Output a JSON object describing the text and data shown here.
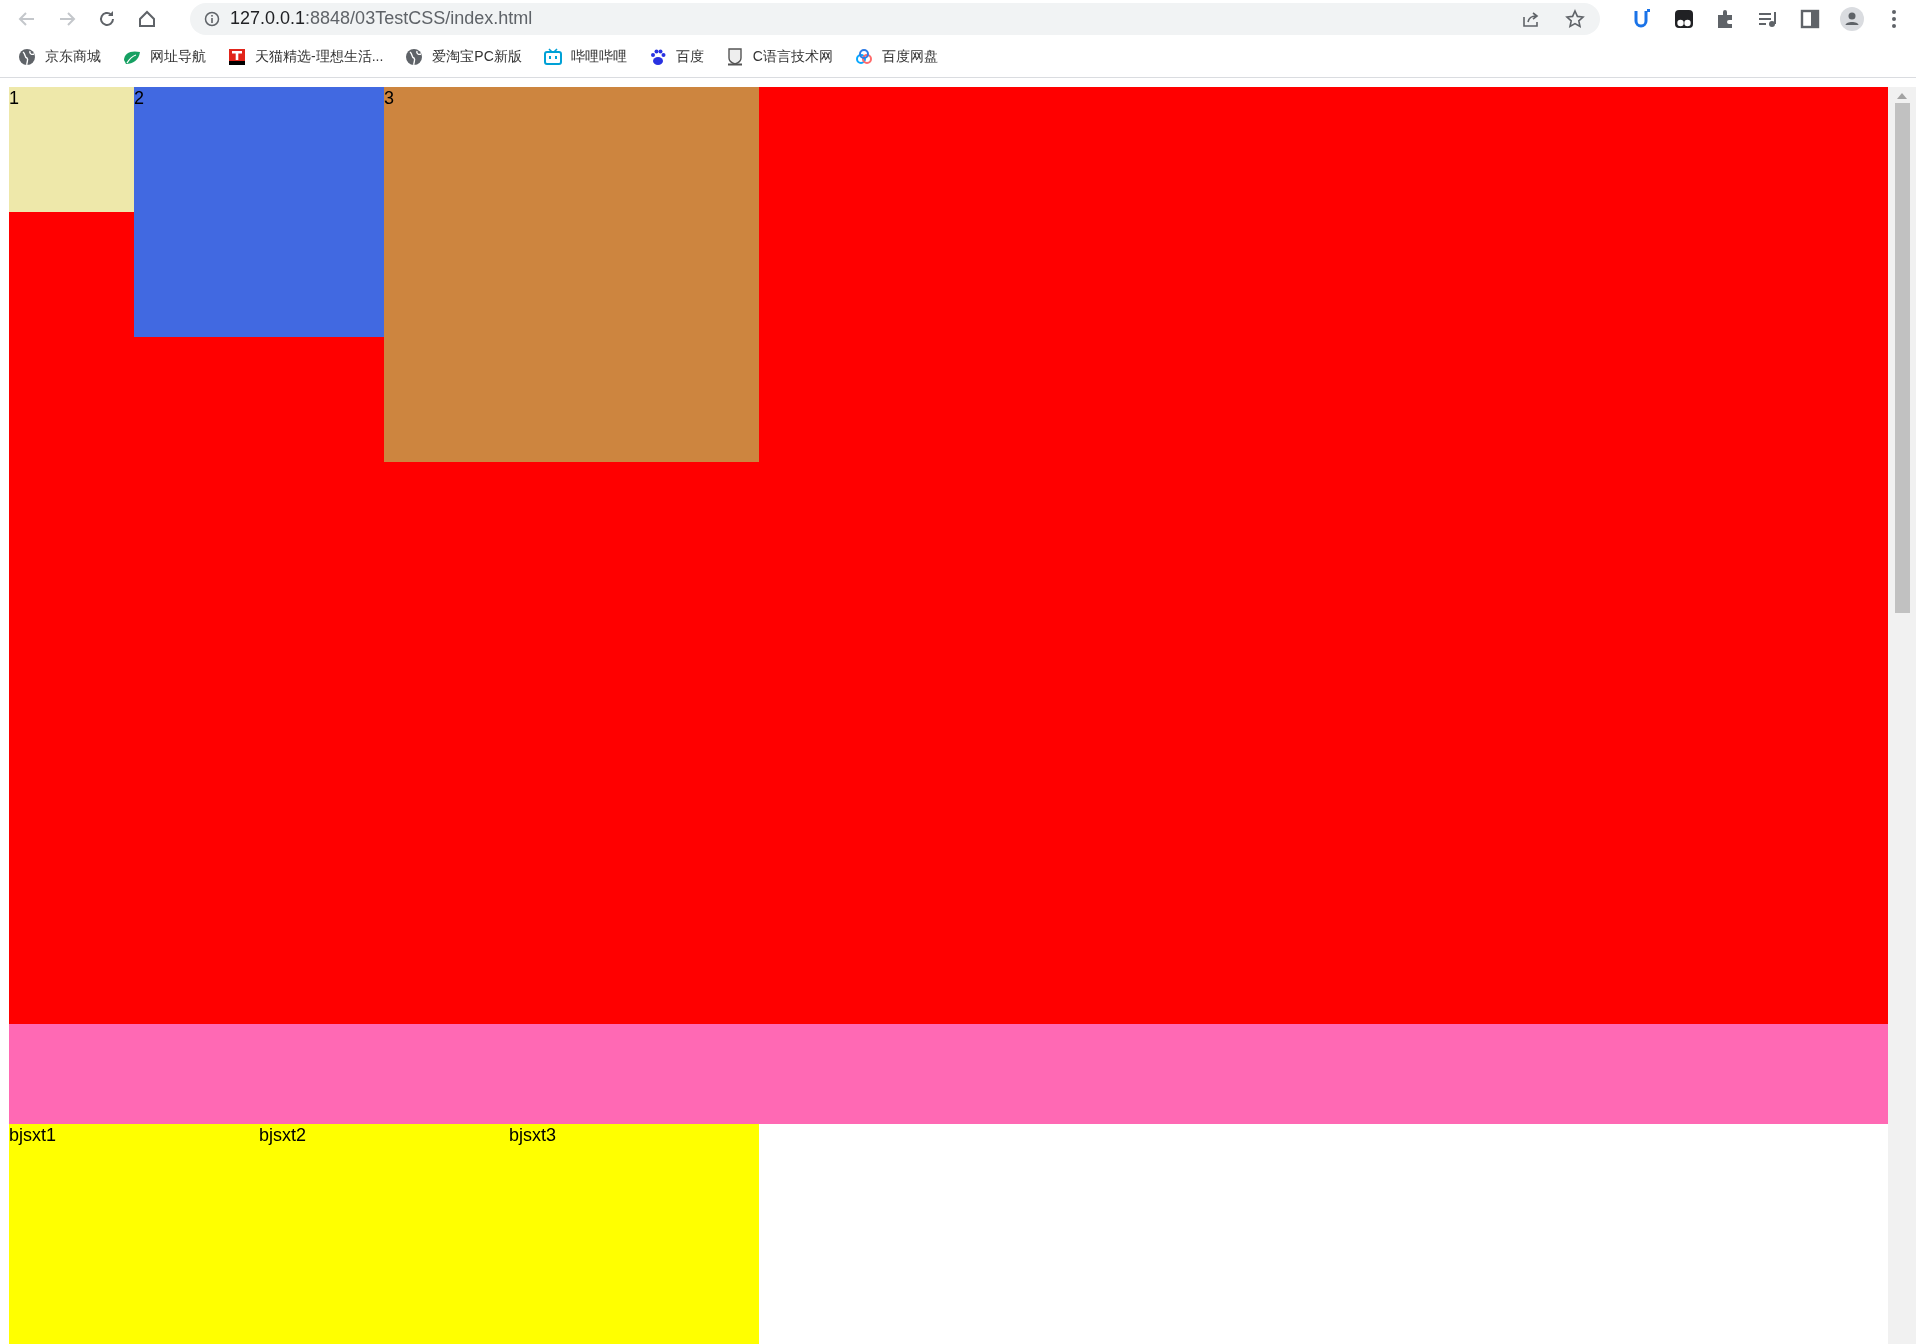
{
  "toolbar": {
    "nav_buttons": [
      {
        "kind": "back",
        "disabled": true
      },
      {
        "kind": "forward",
        "disabled": true
      },
      {
        "kind": "reload",
        "disabled": false
      },
      {
        "kind": "home",
        "disabled": false
      }
    ],
    "address": {
      "host": "127.0.0.1",
      "path": ":8848/03TestCSS/index.html"
    },
    "extensions": [
      {
        "kind": "u"
      },
      {
        "kind": "mask"
      },
      {
        "kind": "puzzle"
      },
      {
        "kind": "media"
      },
      {
        "kind": "sidepanel"
      },
      {
        "kind": "profile"
      },
      {
        "kind": "more"
      }
    ]
  },
  "bookmarks": [
    {
      "label": "京东商城",
      "kind": "globe"
    },
    {
      "label": "网址导航",
      "kind": "leaf"
    },
    {
      "label": "天猫精选-理想生活...",
      "kind": "tile"
    },
    {
      "label": "爱淘宝PC新版",
      "kind": "globe"
    },
    {
      "label": "哔哩哔哩",
      "kind": "tv"
    },
    {
      "label": "百度",
      "kind": "paw"
    },
    {
      "label": "C语言技术网",
      "kind": "shield"
    },
    {
      "label": "百度网盘",
      "kind": "cloud"
    }
  ],
  "page": {
    "floats": [
      {
        "label": "1",
        "color": "#eee8aa"
      },
      {
        "label": "2",
        "color": "#4169e1"
      },
      {
        "label": "3",
        "color": "#cd853f"
      }
    ],
    "items": [
      {
        "label": "bjsxt1"
      },
      {
        "label": "bjsxt2"
      },
      {
        "label": "bjsxt3"
      }
    ]
  }
}
